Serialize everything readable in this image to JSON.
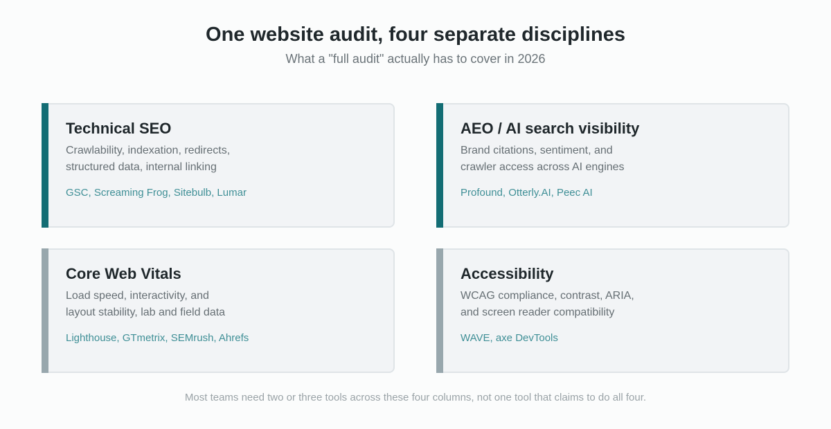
{
  "header": {
    "title": "One website audit, four separate disciplines",
    "subtitle": "What a \"full audit\" actually has to cover in 2026"
  },
  "colors": {
    "accent_teal": "#136d74",
    "accent_gray": "#98a7ad",
    "tool_text": "#3f8f96"
  },
  "cards": [
    {
      "title": "Technical SEO",
      "desc": [
        "Crawlability, indexation, redirects,",
        "structured data, internal linking"
      ],
      "tools": "GSC, Screaming Frog, Sitebulb, Lumar"
    },
    {
      "title": "AEO / AI search visibility",
      "desc": [
        "Brand citations, sentiment, and",
        "crawler access across AI engines"
      ],
      "tools": "Profound, Otterly.AI, Peec AI"
    },
    {
      "title": "Core Web Vitals",
      "desc": [
        "Load speed, interactivity, and",
        "layout stability, lab and field data"
      ],
      "tools": "Lighthouse, GTmetrix, SEMrush, Ahrefs"
    },
    {
      "title": "Accessibility",
      "desc": [
        "WCAG compliance, contrast, ARIA,",
        "and screen reader compatibility"
      ],
      "tools": "WAVE, axe DevTools"
    }
  ],
  "footer": {
    "note": "Most teams need two or three tools across these four columns, not one tool that claims to do all four."
  }
}
